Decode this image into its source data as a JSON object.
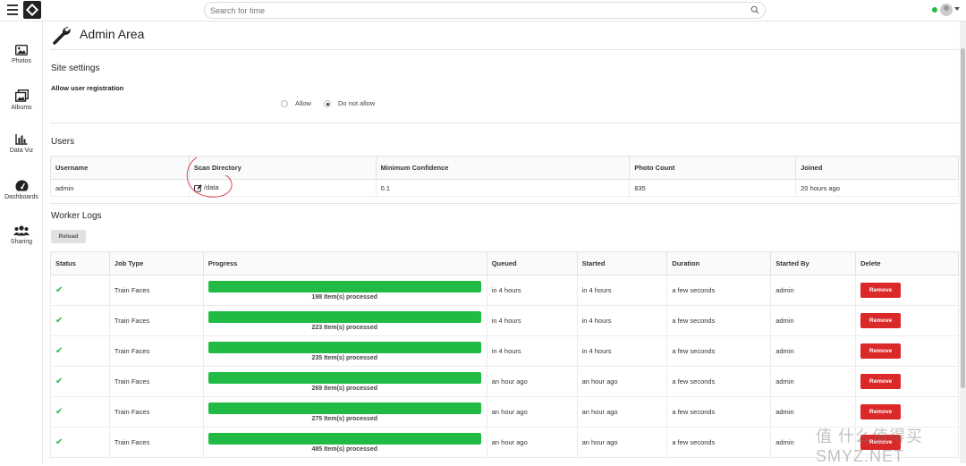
{
  "header": {
    "search_placeholder": "Search for time"
  },
  "sidebar": {
    "items": [
      {
        "label": "Photos",
        "icon": "image-icon"
      },
      {
        "label": "Albums",
        "icon": "albums-icon"
      },
      {
        "label": "Data Viz",
        "icon": "bar-chart-icon"
      },
      {
        "label": "Dashboards",
        "icon": "dashboard-icon"
      },
      {
        "label": "Sharing",
        "icon": "users-icon"
      }
    ]
  },
  "page": {
    "title": "Admin Area"
  },
  "site_settings": {
    "title": "Site settings",
    "field_label": "Allow user registration",
    "options": [
      "Allow",
      "Do not allow"
    ],
    "selected": "Do not allow"
  },
  "users": {
    "title": "Users",
    "columns": [
      "Username",
      "Scan Directory",
      "Minimum Confidence",
      "Photo Count",
      "Joined"
    ],
    "rows": [
      {
        "username": "admin",
        "scan_directory": "/data",
        "min_confidence": "0.1",
        "photo_count": "835",
        "joined": "20 hours ago"
      }
    ]
  },
  "worker_logs": {
    "title": "Worker Logs",
    "reload_label": "Reload",
    "columns": [
      "Status",
      "Job Type",
      "Progress",
      "Queued",
      "Started",
      "Duration",
      "Started By",
      "Delete"
    ],
    "remove_label": "Remove",
    "rows": [
      {
        "job_type": "Train Faces",
        "progress_label": "198 Item(s) processed",
        "progress": 100,
        "queued": "in 4 hours",
        "started": "in 4 hours",
        "duration": "a few seconds",
        "started_by": "admin"
      },
      {
        "job_type": "Train Faces",
        "progress_label": "223 Item(s) processed",
        "progress": 100,
        "queued": "in 4 hours",
        "started": "in 4 hours",
        "duration": "a few seconds",
        "started_by": "admin"
      },
      {
        "job_type": "Train Faces",
        "progress_label": "235 Item(s) processed",
        "progress": 100,
        "queued": "in 4 hours",
        "started": "in 4 hours",
        "duration": "a few seconds",
        "started_by": "admin"
      },
      {
        "job_type": "Train Faces",
        "progress_label": "269 Item(s) processed",
        "progress": 100,
        "queued": "an hour ago",
        "started": "an hour ago",
        "duration": "a few seconds",
        "started_by": "admin"
      },
      {
        "job_type": "Train Faces",
        "progress_label": "275 Item(s) processed",
        "progress": 100,
        "queued": "an hour ago",
        "started": "an hour ago",
        "duration": "a few seconds",
        "started_by": "admin"
      },
      {
        "job_type": "Train Faces",
        "progress_label": "485 Item(s) processed",
        "progress": 100,
        "queued": "an hour ago",
        "started": "an hour ago",
        "duration": "a few seconds",
        "started_by": "admin"
      }
    ]
  },
  "colors": {
    "success": "#21ba45",
    "danger": "#db2828",
    "annotation": "#e0303a"
  },
  "watermark": "值 什么值得买 SMYZ.NET"
}
